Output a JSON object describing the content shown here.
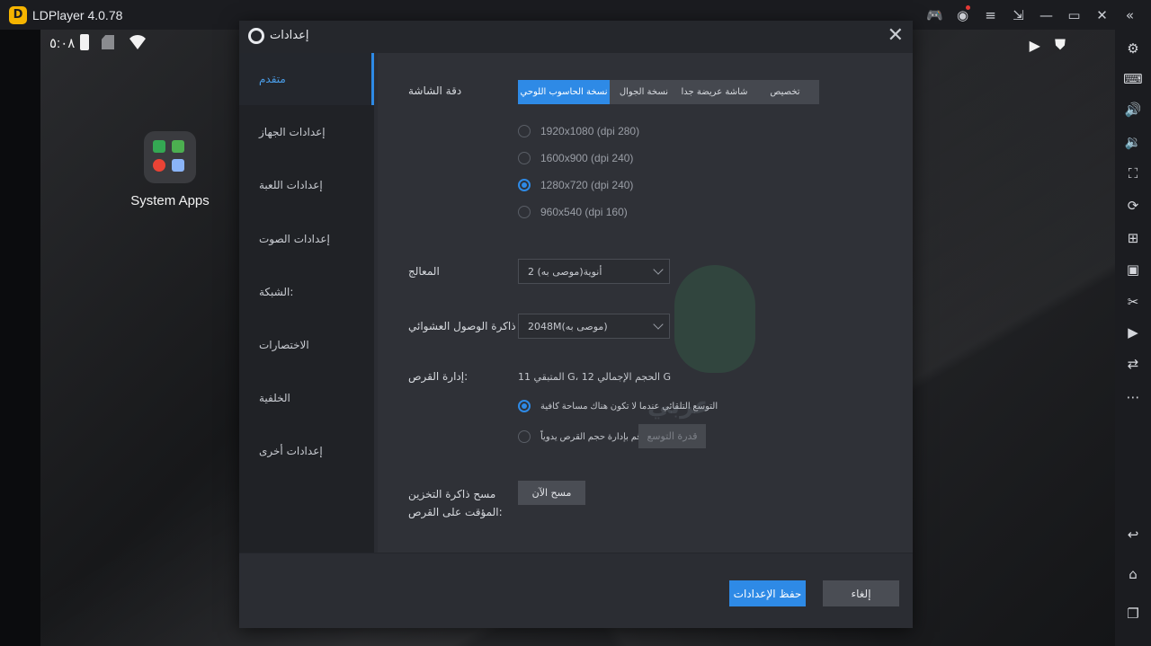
{
  "window": {
    "title": "LDPlayer 4.0.78"
  },
  "android": {
    "status_time": "٥:٠٨",
    "app_label": "System Apps"
  },
  "dialog": {
    "title": "إعدادات",
    "sidebar": [
      {
        "label": "متقدم",
        "active": true
      },
      {
        "label": "إعدادات الجهاز",
        "active": false
      },
      {
        "label": "إعدادات اللعبة",
        "active": false
      },
      {
        "label": "إعدادات الصوت",
        "active": false
      },
      {
        "label": "الشبكة:",
        "active": false
      },
      {
        "label": "الاختصارات",
        "active": false
      },
      {
        "label": "الخلفية",
        "active": false
      },
      {
        "label": "إعدادات أخرى",
        "active": false
      }
    ],
    "resolution": {
      "label": "دقة الشاشة",
      "tabs": [
        "نسخة الحاسوب اللوحي",
        "نسخة الجوال",
        "شاشة عريضة جدا",
        "تخصيص"
      ],
      "options": [
        "1920x1080  (dpi 280)",
        "1600x900  (dpi 240)",
        "1280x720  (dpi 240)",
        "960x540  (dpi 160)"
      ],
      "selected_index": 2
    },
    "cpu": {
      "label": "المعالج",
      "value": "أنوية(موصى به) 2"
    },
    "ram": {
      "label": "ذاكرة الوصول العشوائي",
      "value": "2048M(موصى به)"
    },
    "disk": {
      "label": "إدارة القرص:",
      "info": "المتبقي 11 G، الحجم الإجمالي 12 G",
      "auto_expand": "التوسع التلقائي عندما لا تكون هناك مساحة كافية",
      "manual": "قم بإدارة حجم القرص يدوياً",
      "expand_button": "قدرة التوسع"
    },
    "cache": {
      "label_line1": "مسح ذاكرة التخزين",
      "label_line2": "المؤقت على القرص:",
      "button": "مسح الآن"
    },
    "footer": {
      "save": "حفظ الإعدادات",
      "cancel": "إلغاء"
    }
  },
  "colors": {
    "accent": "#2e8ae6",
    "dialog_bg": "#2f3137",
    "sidebar_bg": "#202226"
  }
}
